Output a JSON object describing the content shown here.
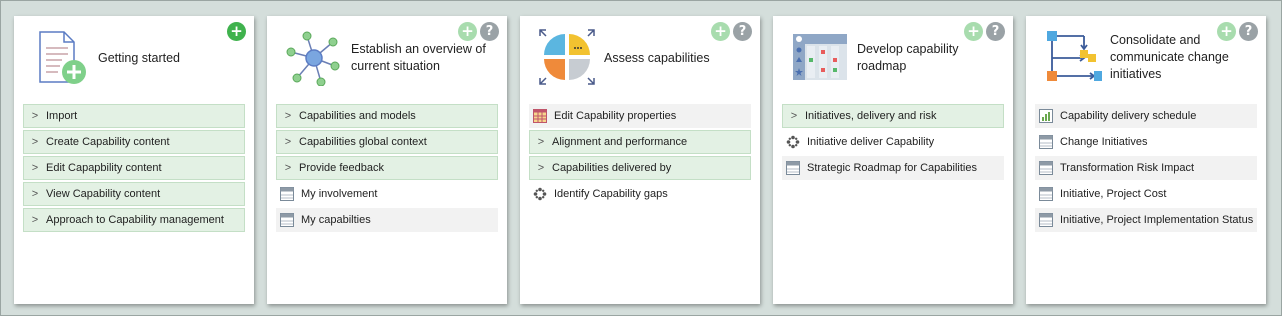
{
  "cards": [
    {
      "title": "Getting started",
      "add_icon": "plus-icon",
      "items": [
        {
          "label": "Import"
        },
        {
          "label": "Create Capability content"
        },
        {
          "label": "Edit Capapbility content"
        },
        {
          "label": "View Capability content"
        },
        {
          "label": "Approach to Capability management"
        }
      ]
    },
    {
      "title": "Establish an overview of current situation",
      "items": [
        {
          "label": "Capabilities and models"
        },
        {
          "label": "Capabilities global context"
        },
        {
          "label": "Provide feedback"
        },
        {
          "label": "My involvement"
        },
        {
          "label": "My capabilties"
        }
      ]
    },
    {
      "title": "Assess capabilities",
      "items": [
        {
          "label": "Edit Capability properties"
        },
        {
          "label": "Alignment and performance"
        },
        {
          "label": "Capabilities delivered by"
        },
        {
          "label": "Identify Capability gaps"
        }
      ]
    },
    {
      "title": "Develop capability roadmap",
      "items": [
        {
          "label": "Initiatives, delivery and risk"
        },
        {
          "label": "Initiative deliver Capability"
        },
        {
          "label": "Strategic Roadmap for Capabilities"
        }
      ]
    },
    {
      "title": "Consolidate and communicate change initiatives",
      "items": [
        {
          "label": "Capability delivery schedule"
        },
        {
          "label": "Change Initiatives"
        },
        {
          "label": "Transformation Risk Impact"
        },
        {
          "label": "Initiative, Project Cost"
        },
        {
          "label": "Initiative, Project Implementation Status"
        }
      ]
    }
  ],
  "glyphs": {
    "add": "+",
    "help": "?",
    "chevron": ">"
  },
  "colors": {
    "accent_green": "#3fb24d",
    "expandable_bg": "#e3f1e4",
    "help_grey": "#9aa2a6"
  }
}
